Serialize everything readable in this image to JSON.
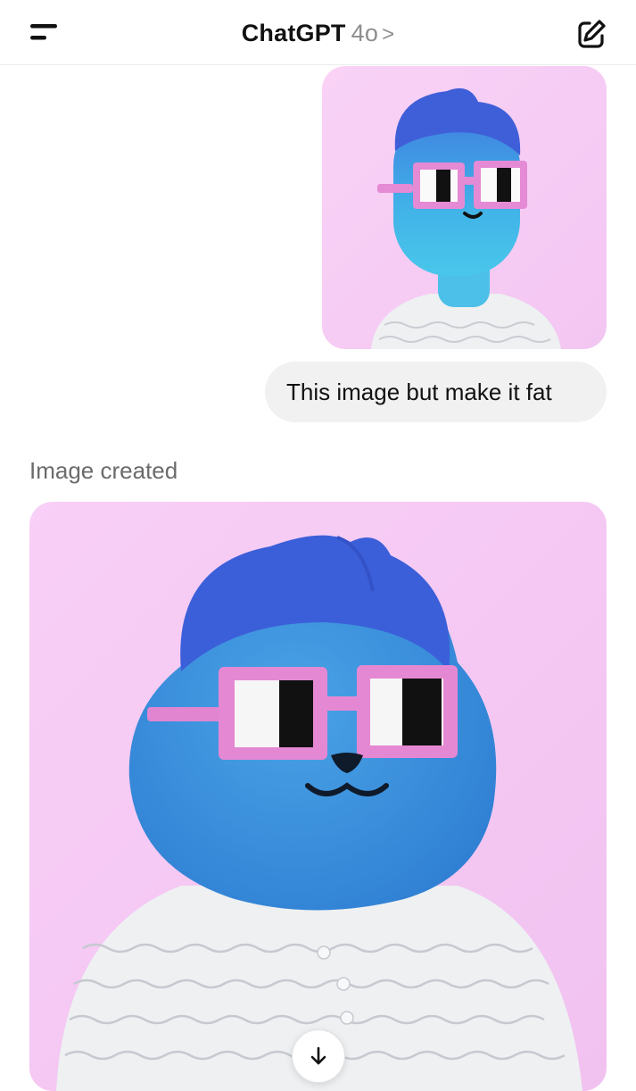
{
  "header": {
    "app_name": "ChatGPT",
    "model": "4o",
    "chevron": ">",
    "menu_icon": "menu-icon",
    "new_chat_icon": "new-chat-icon"
  },
  "conversation": {
    "user_image": "avatar-reference-image",
    "user_message": "This image but make it fat",
    "assistant_status": "Image created",
    "generated_image": "fat-avatar-generated-image"
  },
  "scroll_button": {
    "icon": "arrow-down-icon"
  },
  "colors": {
    "background": "#ffffff",
    "bubble": "#f1f1f1",
    "image_bg": "#f6c8f4",
    "avatar_blue": "#3a8fdc",
    "hair_blue": "#3f63de",
    "glasses_pink": "#e58ad4"
  }
}
